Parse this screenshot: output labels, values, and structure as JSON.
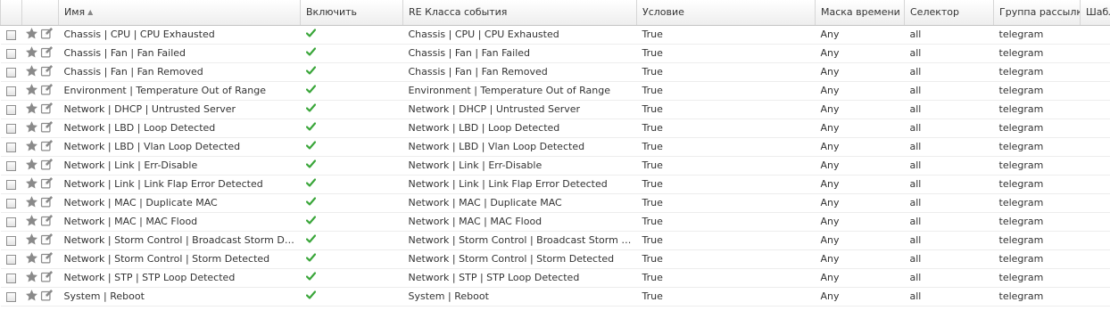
{
  "columns": {
    "name": "Имя",
    "enable": "Включить",
    "re_event_class": "RE Класса события",
    "condition": "Условие",
    "time_mask": "Маска времени",
    "selector": "Селектор",
    "notification_group": "Группа рассылки",
    "template": "Шабл"
  },
  "sort": {
    "column": "name",
    "direction": "asc"
  },
  "icons": {
    "star": "star-icon",
    "edit": "edit-icon",
    "enabled": "checkmark-icon",
    "sort": "sort-ascending-icon"
  },
  "colors": {
    "check_green": "#3aa63a",
    "action_icon_gray": "#8a8a8a"
  },
  "rows": [
    {
      "name": "Chassis | CPU | CPU Exhausted",
      "enabled": true,
      "re": "Chassis | CPU | CPU Exhausted",
      "condition": "True",
      "time_mask": "Any",
      "selector": "all",
      "group": "telegram"
    },
    {
      "name": "Chassis | Fan | Fan Failed",
      "enabled": true,
      "re": "Chassis | Fan | Fan Failed",
      "condition": "True",
      "time_mask": "Any",
      "selector": "all",
      "group": "telegram"
    },
    {
      "name": "Chassis | Fan | Fan Removed",
      "enabled": true,
      "re": "Chassis | Fan | Fan Removed",
      "condition": "True",
      "time_mask": "Any",
      "selector": "all",
      "group": "telegram"
    },
    {
      "name": "Environment | Temperature Out of Range",
      "enabled": true,
      "re": "Environment | Temperature Out of Range",
      "condition": "True",
      "time_mask": "Any",
      "selector": "all",
      "group": "telegram"
    },
    {
      "name": "Network | DHCP | Untrusted Server",
      "enabled": true,
      "re": "Network | DHCP | Untrusted Server",
      "condition": "True",
      "time_mask": "Any",
      "selector": "all",
      "group": "telegram"
    },
    {
      "name": "Network | LBD | Loop Detected",
      "enabled": true,
      "re": "Network | LBD | Loop Detected",
      "condition": "True",
      "time_mask": "Any",
      "selector": "all",
      "group": "telegram"
    },
    {
      "name": "Network | LBD | Vlan Loop Detected",
      "enabled": true,
      "re": "Network | LBD | Vlan Loop Detected",
      "condition": "True",
      "time_mask": "Any",
      "selector": "all",
      "group": "telegram"
    },
    {
      "name": "Network | Link | Err-Disable",
      "enabled": true,
      "re": "Network | Link | Err-Disable",
      "condition": "True",
      "time_mask": "Any",
      "selector": "all",
      "group": "telegram"
    },
    {
      "name": "Network | Link | Link Flap Error Detected",
      "enabled": true,
      "re": "Network | Link | Link Flap Error Detected",
      "condition": "True",
      "time_mask": "Any",
      "selector": "all",
      "group": "telegram"
    },
    {
      "name": "Network | MAC | Duplicate MAC",
      "enabled": true,
      "re": "Network | MAC | Duplicate MAC",
      "condition": "True",
      "time_mask": "Any",
      "selector": "all",
      "group": "telegram"
    },
    {
      "name": "Network | MAC | MAC Flood",
      "enabled": true,
      "re": "Network | MAC | MAC Flood",
      "condition": "True",
      "time_mask": "Any",
      "selector": "all",
      "group": "telegram"
    },
    {
      "name": "Network | Storm Control | Broadcast Storm Detected",
      "enabled": true,
      "re": "Network | Storm Control | Broadcast Storm Dete...",
      "condition": "True",
      "time_mask": "Any",
      "selector": "all",
      "group": "telegram"
    },
    {
      "name": "Network | Storm Control | Storm Detected",
      "enabled": true,
      "re": "Network | Storm Control | Storm Detected",
      "condition": "True",
      "time_mask": "Any",
      "selector": "all",
      "group": "telegram"
    },
    {
      "name": "Network | STP | STP Loop Detected",
      "enabled": true,
      "re": "Network | STP | STP Loop Detected",
      "condition": "True",
      "time_mask": "Any",
      "selector": "all",
      "group": "telegram"
    },
    {
      "name": "System | Reboot",
      "enabled": true,
      "re": "System | Reboot",
      "condition": "True",
      "time_mask": "Any",
      "selector": "all",
      "group": "telegram"
    }
  ]
}
